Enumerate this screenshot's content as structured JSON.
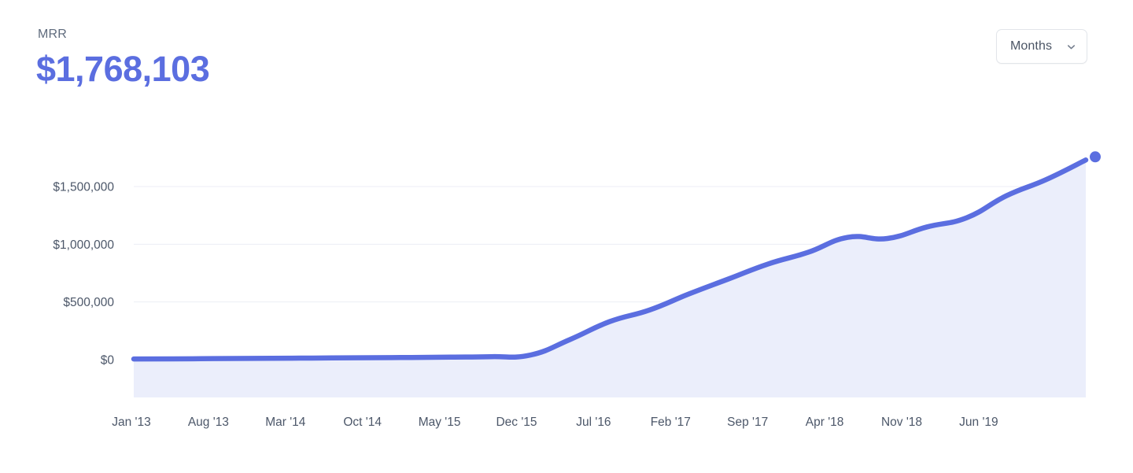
{
  "header": {
    "metric_label": "MRR",
    "metric_value": "$1,768,103",
    "range_select": {
      "value": "Months",
      "icon": "chevron-down-icon"
    }
  },
  "colors": {
    "accent": "#5b6ee0",
    "area_fill": "#ebeefb",
    "gridline": "#eceef4",
    "tick_text": "#4c5769",
    "label_text": "#5f6b7d"
  },
  "chart_data": {
    "type": "area",
    "title": "MRR",
    "xlabel": "",
    "ylabel": "",
    "grid": true,
    "legend": false,
    "ylim": [
      0,
      1800000
    ],
    "yticks": [
      0,
      500000,
      1000000,
      1500000
    ],
    "ytick_labels": [
      "$0",
      "$500,000",
      "$1,000,000",
      "$1,500,000"
    ],
    "xtick_labels": [
      "Jan '13",
      "Aug '13",
      "Mar '14",
      "Oct '14",
      "May '15",
      "Dec '15",
      "Jul '16",
      "Feb '17",
      "Sep '17",
      "Apr '18",
      "Nov '18",
      "Jun '19"
    ],
    "series": [
      {
        "name": "MRR",
        "color": "#5b6ee0",
        "final_value": 1768103,
        "x": [
          "Jan '13",
          "Apr '13",
          "Aug '13",
          "Dec '13",
          "Mar '14",
          "Jul '14",
          "Oct '14",
          "Feb '15",
          "May '15",
          "Sep '15",
          "Dec '15",
          "Mar '16",
          "Jul '16",
          "Oct '16",
          "Feb '17",
          "May '17",
          "Sep '17",
          "Dec '17",
          "Apr '18",
          "Jun '18",
          "Aug '18",
          "Nov '18",
          "Feb '19",
          "Jun '19",
          "Sep '19"
        ],
        "values": [
          6000,
          7000,
          9000,
          11000,
          13000,
          15000,
          17000,
          19000,
          22000,
          26000,
          40000,
          175000,
          330000,
          430000,
          570000,
          700000,
          830000,
          930000,
          1060000,
          1050000,
          1150000,
          1230000,
          1420000,
          1560000,
          1730000
        ]
      }
    ]
  }
}
